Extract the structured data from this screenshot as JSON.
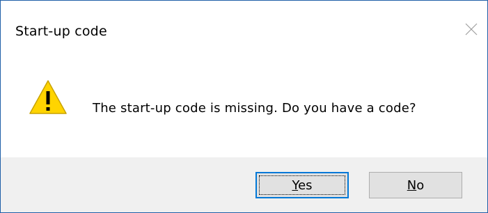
{
  "window": {
    "title": "Start-up code",
    "close_icon": "close-icon"
  },
  "content": {
    "icon": "warning-icon",
    "message": "The start-up code is missing. Do you have a code?"
  },
  "buttons": {
    "yes": {
      "mnemonic": "Y",
      "rest": "es",
      "is_default": true
    },
    "no": {
      "mnemonic": "N",
      "rest": "o",
      "is_default": false
    }
  },
  "colors": {
    "border": "#1f5fa8",
    "footer_bg": "#f0f0f0",
    "button_bg": "#e1e1e1",
    "default_button_border": "#0078d7",
    "warning_fill": "#ffd400"
  }
}
